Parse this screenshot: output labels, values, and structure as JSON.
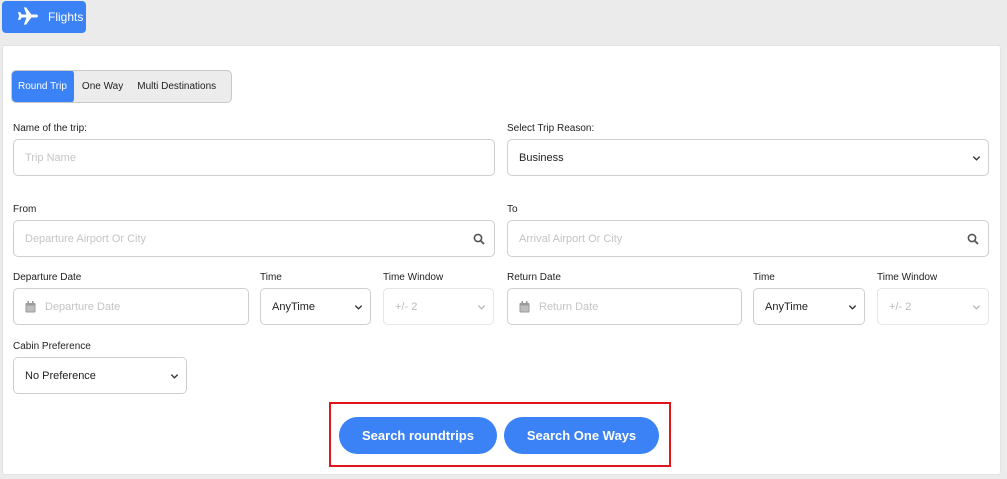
{
  "header": {
    "flights_tab_label": "Flights",
    "flights_icon": "airplane-icon"
  },
  "trip_type": {
    "options": [
      "Round Trip",
      "One Way",
      "Multi Destinations"
    ],
    "selected": "Round Trip"
  },
  "form": {
    "trip_name": {
      "label": "Name of the trip:",
      "placeholder": "Trip Name",
      "value": ""
    },
    "trip_reason": {
      "label": "Select Trip Reason:",
      "value": "Business"
    },
    "from": {
      "label": "From",
      "placeholder": "Departure Airport Or City"
    },
    "to": {
      "label": "To",
      "placeholder": "Arrival Airport Or City"
    },
    "departure_date": {
      "label": "Departure Date",
      "placeholder": "Departure Date"
    },
    "departure_time": {
      "label": "Time",
      "value": "AnyTime"
    },
    "departure_window": {
      "label": "Time Window",
      "value": "+/- 2"
    },
    "return_date": {
      "label": "Return Date",
      "placeholder": "Return Date"
    },
    "return_time": {
      "label": "Time",
      "value": "AnyTime"
    },
    "return_window": {
      "label": "Time Window",
      "value": "+/- 2"
    },
    "cabin": {
      "label": "Cabin Preference",
      "value": "No Preference"
    }
  },
  "actions": {
    "search_roundtrips": "Search roundtrips",
    "search_one_ways": "Search One Ways"
  },
  "colors": {
    "accent": "#3b82f6",
    "highlight_border": "#e3131c"
  }
}
